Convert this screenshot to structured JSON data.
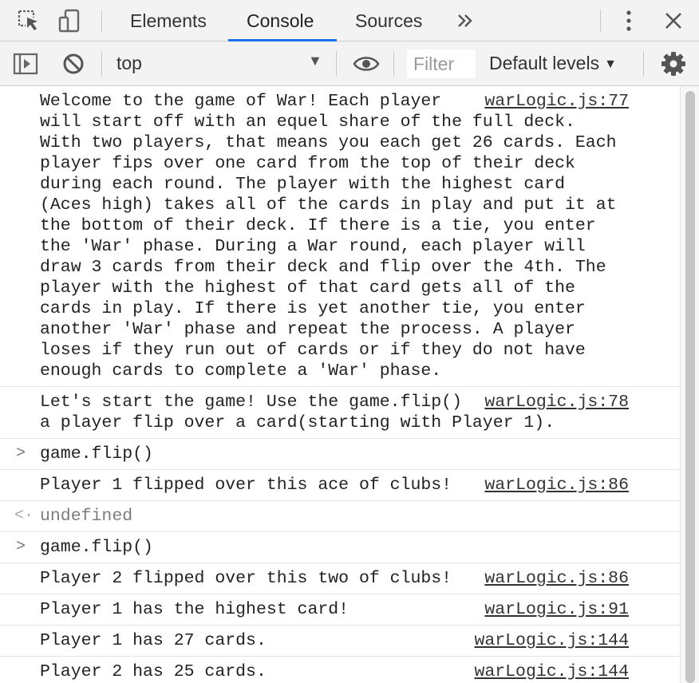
{
  "tabs": [
    {
      "label": "Elements"
    },
    {
      "label": "Console"
    },
    {
      "label": "Sources"
    }
  ],
  "more_tabs_icon": "chevron-double-right-icon",
  "toolbar": {
    "context": "top",
    "filter_placeholder": "Filter",
    "levels": "Default levels"
  },
  "accent": "#1a73e8",
  "messages": [
    {
      "type": "log",
      "source": "warLogic.js:77",
      "text": "Welcome to the game of War! Each player\nwill start off with an equel share of the full deck.\nWith two players, that means you each get 26 cards. Each\nplayer fips over one card from the top of their deck\nduring each round. The player with the highest card\n(Aces high) takes all of the cards in play and put it at\nthe bottom of their deck. If there is a tie, you enter\nthe 'War' phase. During a War round, each player will\ndraw 3 cards from their deck and flip over the 4th. The\nplayer with the highest of that card gets all of the\ncards in play. If there is yet another tie, you enter\nanother 'War' phase and repeat the process. A player\nloses if they run out of cards or if they do not have\nenough cards to complete a 'War' phase."
    },
    {
      "type": "log",
      "source": "warLogic.js:78",
      "text": "Let's start the game! Use the game.flip()\na player flip over a card(starting with Player 1)."
    },
    {
      "type": "input",
      "text": "game.flip()"
    },
    {
      "type": "log",
      "source": "warLogic.js:86",
      "text": "Player 1 flipped over this ace of clubs!"
    },
    {
      "type": "result",
      "text": "undefined"
    },
    {
      "type": "input",
      "text": "game.flip()"
    },
    {
      "type": "log",
      "source": "warLogic.js:86",
      "text": "Player 2 flipped over this two of clubs!"
    },
    {
      "type": "log",
      "source": "warLogic.js:91",
      "text": "Player 1 has the highest card!"
    },
    {
      "type": "log",
      "source": "warLogic.js:144",
      "text": "Player 1 has 27 cards."
    },
    {
      "type": "log",
      "source": "warLogic.js:144",
      "text": "Player 2 has 25 cards."
    }
  ]
}
